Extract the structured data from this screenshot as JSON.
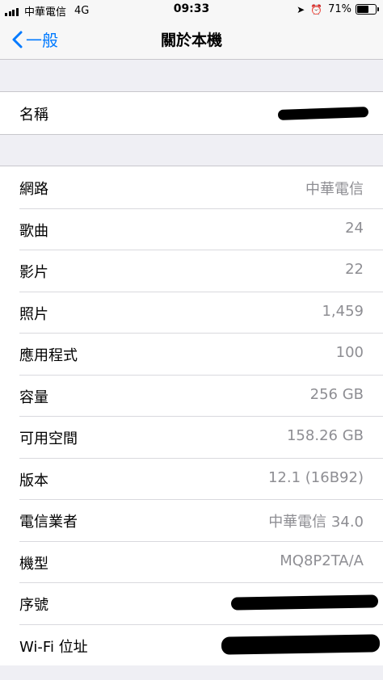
{
  "status_bar": {
    "carrier": "中華電信",
    "network": "4G",
    "time": "09:33",
    "battery": "71%",
    "battery_level": 0.71,
    "icons": [
      "location-arrow-icon",
      "alarm-icon"
    ]
  },
  "nav": {
    "back_label": "一般",
    "back_icon": "chevron-left-icon",
    "title": "關於本機"
  },
  "colors": {
    "accent": "#007aff",
    "background": "#efeff4",
    "value_text": "#8e8e93"
  },
  "name_group": {
    "label": "名稱"
  },
  "info_rows": [
    {
      "label": "網路",
      "value": "中華電信"
    },
    {
      "label": "歌曲",
      "value": "24"
    },
    {
      "label": "影片",
      "value": "22"
    },
    {
      "label": "照片",
      "value": "1,459"
    },
    {
      "label": "應用程式",
      "value": "100"
    },
    {
      "label": "容量",
      "value": "256 GB"
    },
    {
      "label": "可用空間",
      "value": "158.26 GB"
    },
    {
      "label": "版本",
      "value": "12.1 (16B92)"
    },
    {
      "label": "電信業者",
      "value": "中華電信 34.0"
    },
    {
      "label": "機型",
      "value": "MQ8P2TA/A"
    },
    {
      "label": "序號",
      "value": ""
    },
    {
      "label": "Wi-Fi 位址",
      "value": ""
    }
  ]
}
